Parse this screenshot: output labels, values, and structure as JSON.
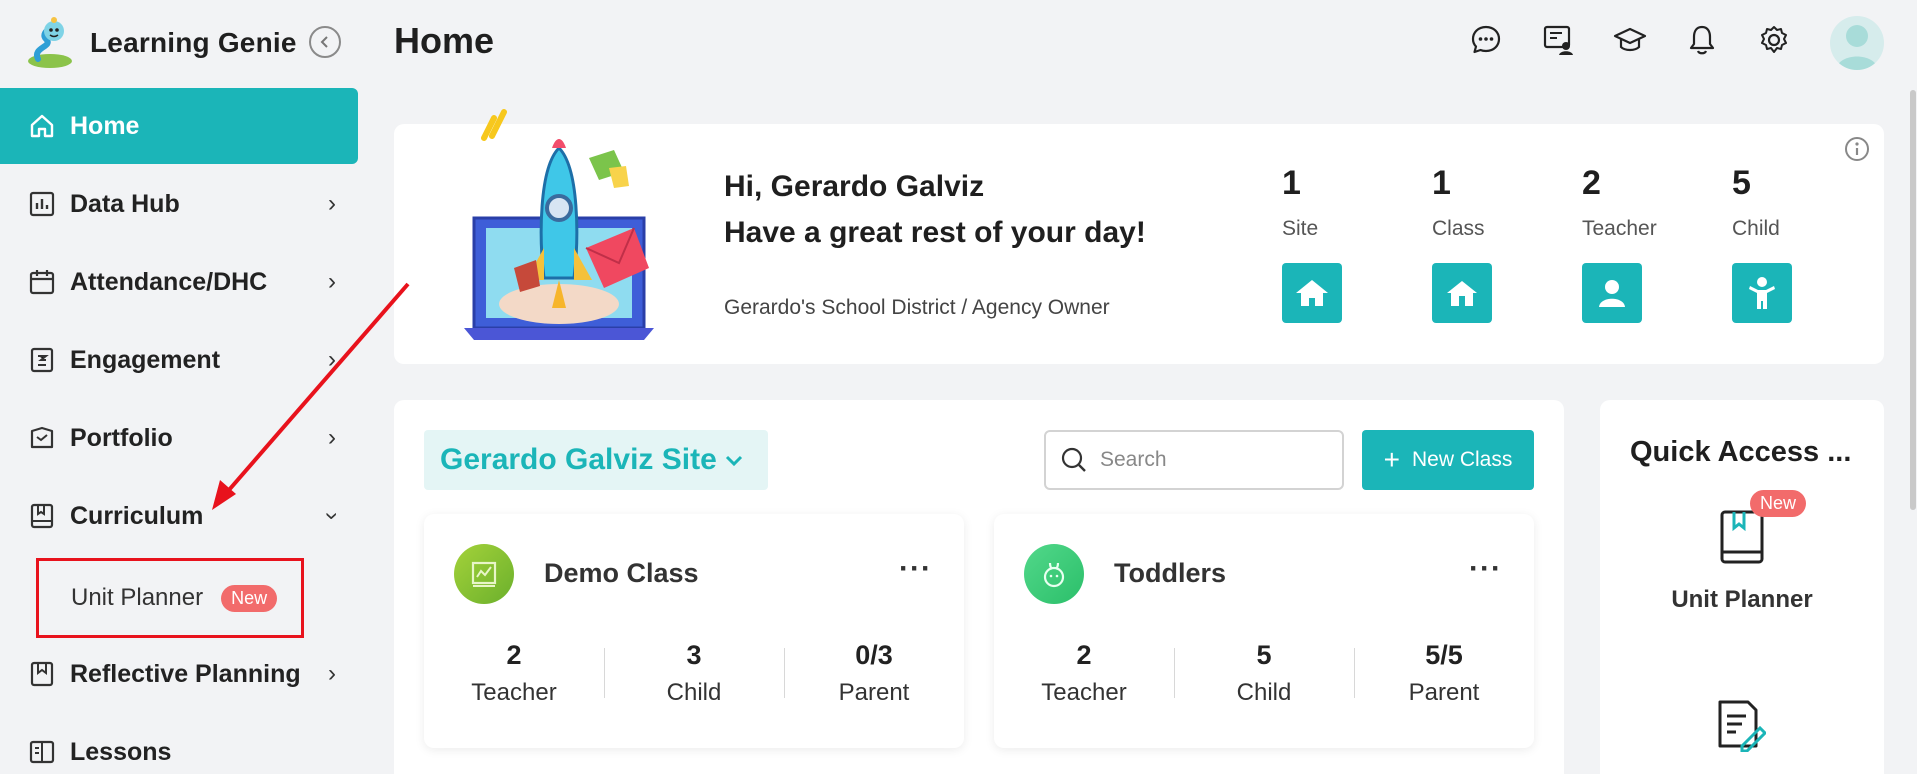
{
  "app": {
    "name": "Learning Genie"
  },
  "page": {
    "title": "Home"
  },
  "sidebar": {
    "items": [
      {
        "label": "Home",
        "icon": "home-icon"
      },
      {
        "label": "Data Hub",
        "icon": "chart-icon"
      },
      {
        "label": "Attendance/DHC",
        "icon": "calendar-icon"
      },
      {
        "label": "Engagement",
        "icon": "engagement-icon"
      },
      {
        "label": "Portfolio",
        "icon": "portfolio-icon"
      },
      {
        "label": "Curriculum",
        "icon": "book-icon"
      },
      {
        "label": "Reflective Planning",
        "icon": "bookmark-icon"
      },
      {
        "label": "Lessons",
        "icon": "lessons-icon"
      }
    ],
    "sub_item": {
      "label": "Unit Planner",
      "badge": "New"
    }
  },
  "welcome": {
    "greeting": "Hi, Gerardo Galviz",
    "message": "Have a great rest of your day!",
    "org": "Gerardo's School District / Agency Owner",
    "stats": [
      {
        "value": "1",
        "label": "Site"
      },
      {
        "value": "1",
        "label": "Class"
      },
      {
        "value": "2",
        "label": "Teacher"
      },
      {
        "value": "5",
        "label": "Child"
      }
    ]
  },
  "classes": {
    "site": "Gerardo Galviz Site",
    "search_placeholder": "Search",
    "new_class_label": "New Class",
    "cards": [
      {
        "name": "Demo Class",
        "stats": [
          {
            "value": "2",
            "label": "Teacher"
          },
          {
            "value": "3",
            "label": "Child"
          },
          {
            "value": "0/3",
            "label": "Parent"
          }
        ]
      },
      {
        "name": "Toddlers",
        "stats": [
          {
            "value": "2",
            "label": "Teacher"
          },
          {
            "value": "5",
            "label": "Child"
          },
          {
            "value": "5/5",
            "label": "Parent"
          }
        ]
      }
    ]
  },
  "quick_access": {
    "title": "Quick Access ...",
    "items": [
      {
        "label": "Unit Planner",
        "badge": "New"
      }
    ]
  },
  "colors": {
    "accent": "#1bb5b8",
    "badge": "#f26b6b",
    "annotation": "#e8121c"
  }
}
